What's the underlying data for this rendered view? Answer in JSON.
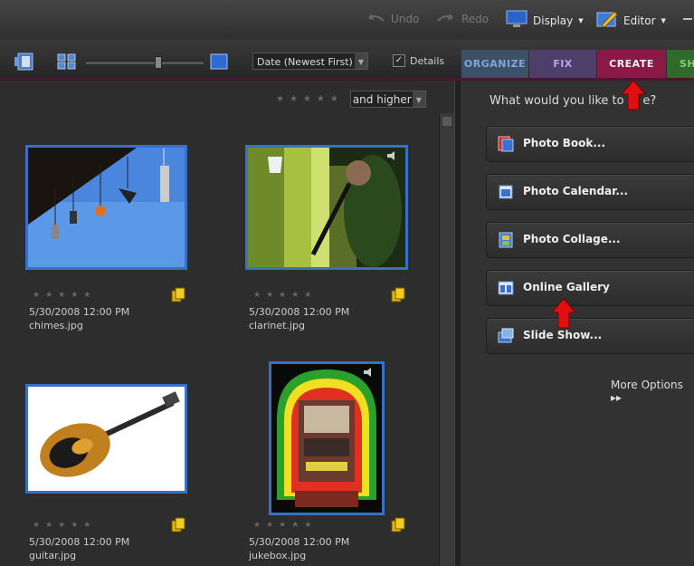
{
  "topbar": {
    "undo": "Undo",
    "redo": "Redo",
    "display": "Display",
    "editor": "Editor"
  },
  "toolbar": {
    "sort": "Date (Newest First)",
    "details": "Details",
    "details_checked": "✓",
    "tabs": [
      {
        "label": "ORGANIZE",
        "color": "#3e5068",
        "text": "#7fa7d6"
      },
      {
        "label": "FIX",
        "color": "#4d3f6a",
        "text": "#b7a6e6"
      },
      {
        "label": "CREATE",
        "color": "#8a1a45",
        "text": "#f2f2f2"
      },
      {
        "label": "SH",
        "color": "#2f6a2a",
        "text": "#7fd07a"
      }
    ]
  },
  "filter": {
    "stars": "★★★★★",
    "selected": "and higher"
  },
  "photos": [
    {
      "stars": "★★★★★",
      "date": "5/30/2008 12:00 PM",
      "name": "chimes.jpg"
    },
    {
      "stars": "★★★★★",
      "date": "5/30/2008 12:00 PM",
      "name": "clarinet.jpg"
    },
    {
      "stars": "★★★★★",
      "date": "5/30/2008 12:00 PM",
      "name": "guitar.jpg"
    },
    {
      "stars": "★★★★★",
      "date": "5/30/2008 12:00 PM",
      "name": "jukebox.jpg"
    }
  ],
  "create_panel": {
    "prompt": "What would you like to cr    e?",
    "buttons": [
      {
        "label": "Photo Book..."
      },
      {
        "label": "Photo Calendar..."
      },
      {
        "label": "Photo Collage..."
      },
      {
        "label": "Online Gallery"
      },
      {
        "label": "Slide Show..."
      }
    ],
    "more": "More Options ▸▸"
  },
  "colors": {
    "accent_create": "#8a1a45",
    "thumb_border": "#3a6fc8",
    "callout_arrow": "#e01010"
  }
}
